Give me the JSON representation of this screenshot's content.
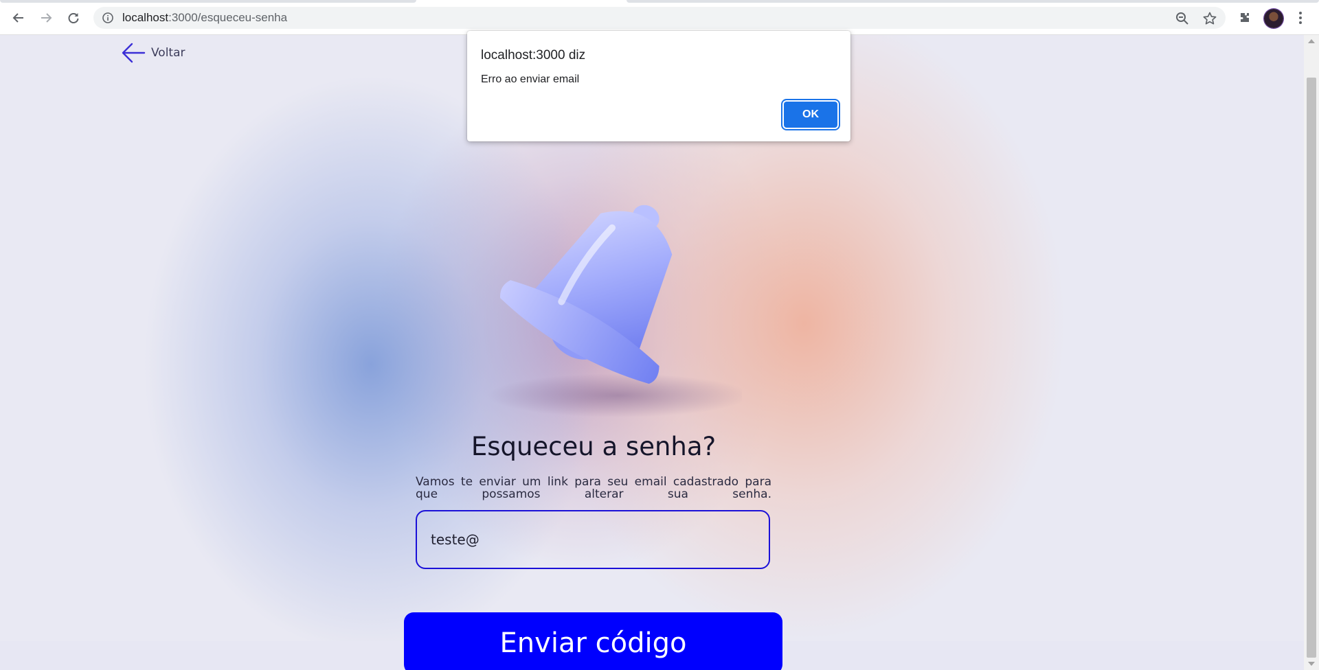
{
  "browser": {
    "url_host": "localhost",
    "url_path": ":3000/esqueceu-senha"
  },
  "page": {
    "back_label": "Voltar",
    "title": "Esqueceu a senha?",
    "description": "Vamos te enviar um link para seu email cadastrado para que possamos alterar sua senha.",
    "email_value": "teste@",
    "submit_label": "Enviar código"
  },
  "dialog": {
    "origin": "localhost:3000 diz",
    "message": "Erro ao enviar email",
    "ok_label": "OK"
  },
  "colors": {
    "primary_button": "#0000fe",
    "input_border": "#1a10d8",
    "dialog_button": "#1a73e8"
  },
  "icons": [
    "back-icon",
    "forward-icon",
    "reload-icon",
    "info-icon",
    "zoom-icon",
    "star-icon",
    "extensions-icon",
    "menu-icon",
    "arrow-left-icon",
    "bell-illustration"
  ]
}
